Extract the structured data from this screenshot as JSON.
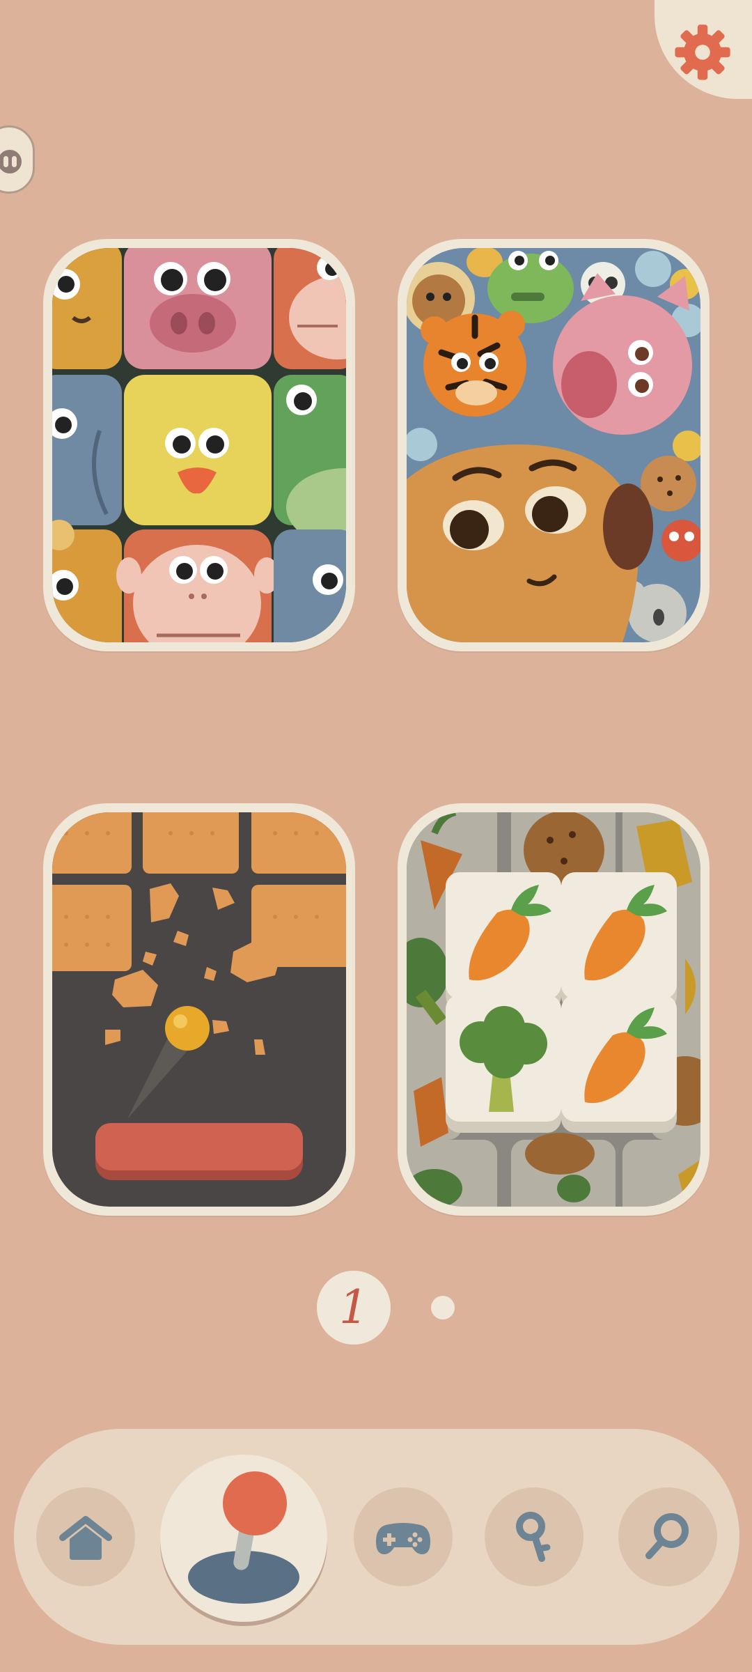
{
  "colors": {
    "background": "#dcb39a",
    "card_frame": "#efe8d8",
    "accent": "#e06b4e",
    "nav_icon": "#6c8494",
    "navbar": "#e8d6c2"
  },
  "header": {
    "settings_icon": "gear-icon",
    "side_handle_icon": "two-dots-icon"
  },
  "games": [
    {
      "id": "animal-blocks",
      "art": "animal-faces-grid"
    },
    {
      "id": "animal-crowd",
      "art": "crowd-of-animal-heads"
    },
    {
      "id": "brick-breaker",
      "art": "cracker-bricks-and-ball"
    },
    {
      "id": "veggie-tiles",
      "art": "carrot-broccoli-tiles"
    }
  ],
  "pager": {
    "current_page": "1",
    "total_pages": 2
  },
  "nav": {
    "items": [
      {
        "id": "home",
        "icon": "home-icon"
      },
      {
        "id": "play",
        "icon": "joystick-icon",
        "selected": true
      },
      {
        "id": "games",
        "icon": "gamepad-icon"
      },
      {
        "id": "keys",
        "icon": "key-icon"
      },
      {
        "id": "search",
        "icon": "search-icon"
      }
    ]
  }
}
